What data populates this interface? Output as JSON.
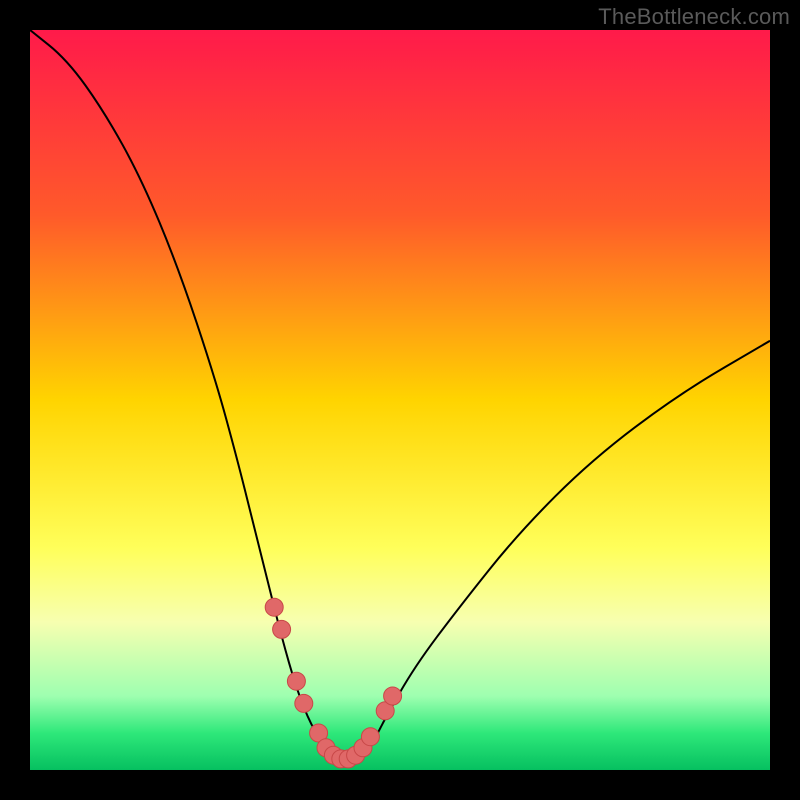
{
  "watermark": "TheBottleneck.com",
  "colors": {
    "frame": "#000000",
    "curve": "#000000",
    "marker_fill": "#e06868",
    "marker_stroke": "#c84848",
    "gradient_stops": [
      {
        "offset": 0.0,
        "color": "#ff1a4a"
      },
      {
        "offset": 0.25,
        "color": "#ff5a2a"
      },
      {
        "offset": 0.5,
        "color": "#ffd400"
      },
      {
        "offset": 0.7,
        "color": "#ffff5a"
      },
      {
        "offset": 0.8,
        "color": "#f7ffb0"
      },
      {
        "offset": 0.9,
        "color": "#9effb0"
      },
      {
        "offset": 0.95,
        "color": "#2ee87a"
      },
      {
        "offset": 1.0,
        "color": "#06c060"
      }
    ]
  },
  "chart_data": {
    "type": "line",
    "title": "",
    "xlabel": "",
    "ylabel": "",
    "xlim": [
      0,
      100
    ],
    "ylim": [
      0,
      100
    ],
    "series": [
      {
        "name": "bottleneck-curve",
        "x": [
          0,
          5,
          10,
          15,
          20,
          25,
          28,
          30,
          32,
          34,
          36,
          38,
          40,
          42,
          44,
          46,
          48,
          52,
          58,
          66,
          76,
          88,
          100
        ],
        "y": [
          100,
          96,
          89,
          80,
          68,
          53,
          42,
          34,
          26,
          18,
          11,
          6,
          3,
          1,
          1,
          3,
          7,
          14,
          22,
          32,
          42,
          51,
          58
        ]
      }
    ],
    "markers": {
      "name": "highlighted-points",
      "x": [
        33,
        34,
        36,
        37,
        39,
        40,
        41,
        42,
        43,
        44,
        45,
        46,
        48,
        49
      ],
      "y": [
        22,
        19,
        12,
        9,
        5,
        3,
        2,
        1.5,
        1.5,
        2,
        3,
        4.5,
        8,
        10
      ]
    },
    "annotations": []
  }
}
